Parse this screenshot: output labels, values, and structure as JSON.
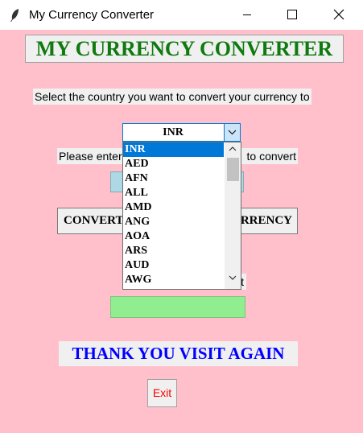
{
  "window": {
    "title": "My Currency Converter"
  },
  "heading": "MY CURRENCY CONVERTER",
  "select_label": "Select the country you want to convert your currency to",
  "currency_select": {
    "value": "INR",
    "options": [
      "INR",
      "AED",
      "AFN",
      "ALL",
      "AMD",
      "ANG",
      "AOA",
      "ARS",
      "AUD",
      "AWG"
    ]
  },
  "amount_label": {
    "left": "Please enter",
    "right": "to convert"
  },
  "amount_input": {
    "value": ""
  },
  "convert_button": {
    "left": "CONVERT",
    "right": "RRENCY"
  },
  "result_label": {
    "right": "t"
  },
  "result_field": {
    "value": ""
  },
  "thanks": "THANK YOU VISIT AGAIN",
  "exit_button": "Exit",
  "colors": {
    "background": "#ffc0cb",
    "heading": "#0f7a0f",
    "thanks": "#0000ff",
    "amount_input": "#add8e6",
    "result_field": "#90ee90",
    "exit_text": "#ff0000",
    "selection": "#0078d7"
  },
  "icons": {
    "app": "feather-icon",
    "minimize": "minimize-icon",
    "maximize": "maximize-icon",
    "close": "close-icon",
    "dropdown": "chevron-down-icon",
    "scroll_up": "scroll-up-icon",
    "scroll_down": "scroll-down-icon"
  }
}
